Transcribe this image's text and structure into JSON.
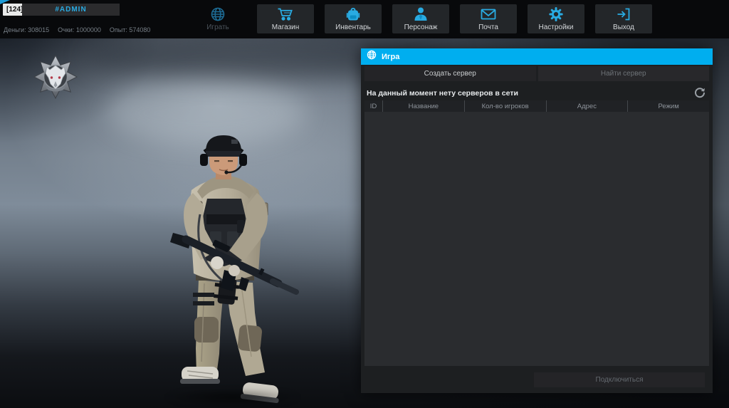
{
  "player": {
    "level_tag": "[124]",
    "name": "#ADMIN",
    "stats": [
      {
        "label": "Деньги:",
        "value": "308015"
      },
      {
        "label": "Очки:",
        "value": "1000000"
      },
      {
        "label": "Опыт:",
        "value": "574080"
      }
    ]
  },
  "nav": {
    "items": [
      {
        "label": "Играть",
        "icon": "globe-icon",
        "active": true
      },
      {
        "label": "Магазин",
        "icon": "cart-icon",
        "active": false
      },
      {
        "label": "Инвентарь",
        "icon": "backpack-icon",
        "active": false
      },
      {
        "label": "Персонаж",
        "icon": "person-icon",
        "active": false
      },
      {
        "label": "Почта",
        "icon": "mail-icon",
        "active": false
      },
      {
        "label": "Настройки",
        "icon": "gear-icon",
        "active": false
      },
      {
        "label": "Выход",
        "icon": "exit-icon",
        "active": false
      }
    ]
  },
  "panel": {
    "title": "Игра",
    "tabs": [
      {
        "label": "Создать сервер",
        "active": true
      },
      {
        "label": "Найти сервер",
        "active": false
      }
    ],
    "empty_message": "На данный момент нету серверов в сети",
    "table": {
      "columns": [
        "ID",
        "Название",
        "Кол-во игроков",
        "Адрес",
        "Режим"
      ],
      "rows": []
    },
    "connect_button": "Подключиться"
  },
  "colors": {
    "accent_header": "#00aeef",
    "icon_cyan": "#29abe2",
    "icon_dimmed": "#1d6b94",
    "topbar_bg": "#08090b",
    "panel_bg": "#1d1f21",
    "list_bg": "#2a2c2f"
  }
}
